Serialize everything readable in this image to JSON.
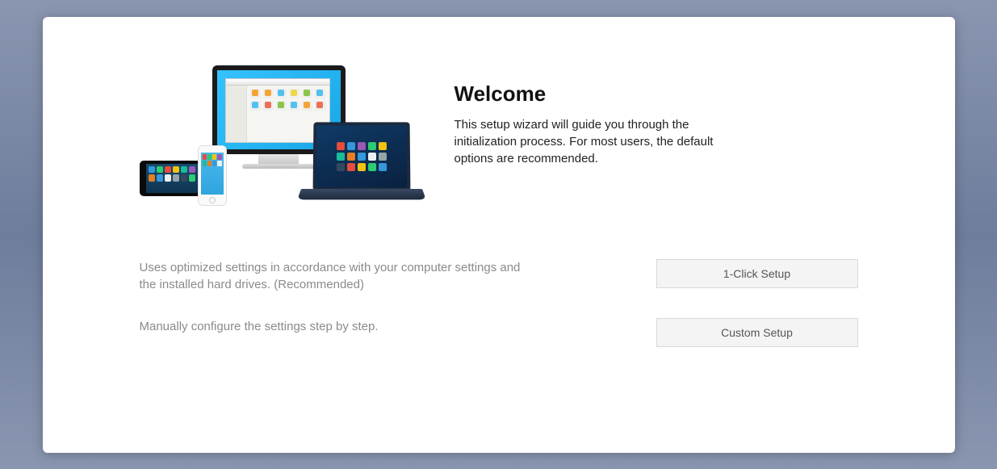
{
  "welcome": {
    "title": "Welcome",
    "description": "This setup wizard will guide you through the initialization process. For most users, the default options are recommended."
  },
  "options": {
    "one_click": {
      "description": "Uses optimized settings in accordance with your computer settings and the installed hard drives. (Recommended)",
      "button_label": "1-Click Setup"
    },
    "custom": {
      "description": "Manually configure the settings step by step.",
      "button_label": "Custom Setup"
    }
  }
}
